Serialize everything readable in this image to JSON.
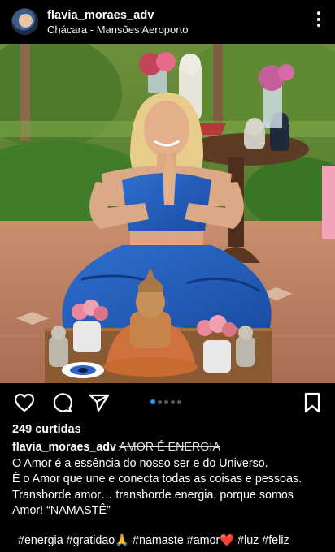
{
  "post": {
    "username": "flavia_moraes_adv",
    "location": "Chácara - Mansões Aeroporto",
    "likes_text": "249 curtidas",
    "carousel": {
      "count": 5,
      "active_index": 0
    },
    "caption": {
      "username": "flavia_moraes_adv",
      "struck_title": "AMOR É ENERGIA",
      "line1": "O Amor é a essência do nosso ser e do Universo.",
      "line2": "É o Amor que une e conecta todas as coisas e pessoas.",
      "line3": "Transborde amor… transborde energia, porque somos",
      "line4": "Amor! “NAMASTÊ”"
    },
    "hashtags": "#energia #gratidao🙏 #namaste #amor❤️ #luz #feliz"
  },
  "icons": {
    "more": "more-vertical-icon",
    "like": "heart-icon",
    "comment": "comment-icon",
    "share": "send-icon",
    "save": "bookmark-icon"
  },
  "colors": {
    "background": "#000000",
    "text": "#ffffff",
    "carousel_active": "#3897f0",
    "carousel_inactive": "#5c5c5c"
  }
}
